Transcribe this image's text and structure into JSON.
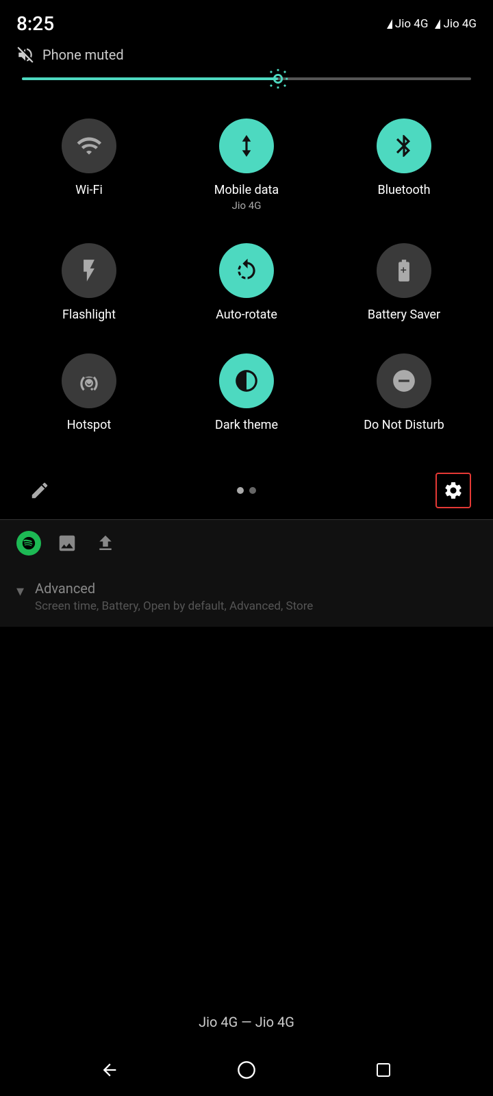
{
  "status": {
    "time": "8:25",
    "network1": "Jio 4G",
    "network2": "Jio 4G"
  },
  "notification": {
    "muted_label": "Phone muted"
  },
  "brightness": {
    "fill_percent": 57
  },
  "quick_settings": {
    "items": [
      {
        "id": "wifi",
        "label": "Wi-Fi",
        "sublabel": "",
        "active": false,
        "icon": "wifi"
      },
      {
        "id": "mobile-data",
        "label": "Mobile data",
        "sublabel": "Jio 4G",
        "active": true,
        "icon": "mobile-data"
      },
      {
        "id": "bluetooth",
        "label": "Bluetooth",
        "sublabel": "",
        "active": true,
        "icon": "bluetooth"
      },
      {
        "id": "flashlight",
        "label": "Flashlight",
        "sublabel": "",
        "active": false,
        "icon": "flashlight"
      },
      {
        "id": "auto-rotate",
        "label": "Auto-rotate",
        "sublabel": "",
        "active": true,
        "icon": "auto-rotate"
      },
      {
        "id": "battery-saver",
        "label": "Battery Saver",
        "sublabel": "",
        "active": false,
        "icon": "battery-saver"
      },
      {
        "id": "hotspot",
        "label": "Hotspot",
        "sublabel": "",
        "active": false,
        "icon": "hotspot"
      },
      {
        "id": "dark-theme",
        "label": "Dark theme",
        "sublabel": "",
        "active": true,
        "icon": "dark-theme"
      },
      {
        "id": "do-not-disturb",
        "label": "Do Not Disturb",
        "sublabel": "",
        "active": false,
        "icon": "do-not-disturb"
      }
    ],
    "page_dots": [
      true,
      false
    ],
    "edit_label": "edit",
    "settings_label": "settings"
  },
  "advanced": {
    "title": "Advanced",
    "subtitle": "Screen time, Battery, Open by default, Advanced, Store"
  },
  "carrier": {
    "label": "Jio 4G — Jio 4G"
  },
  "nav": {
    "back": "◀",
    "home": "●",
    "recents": "■"
  }
}
